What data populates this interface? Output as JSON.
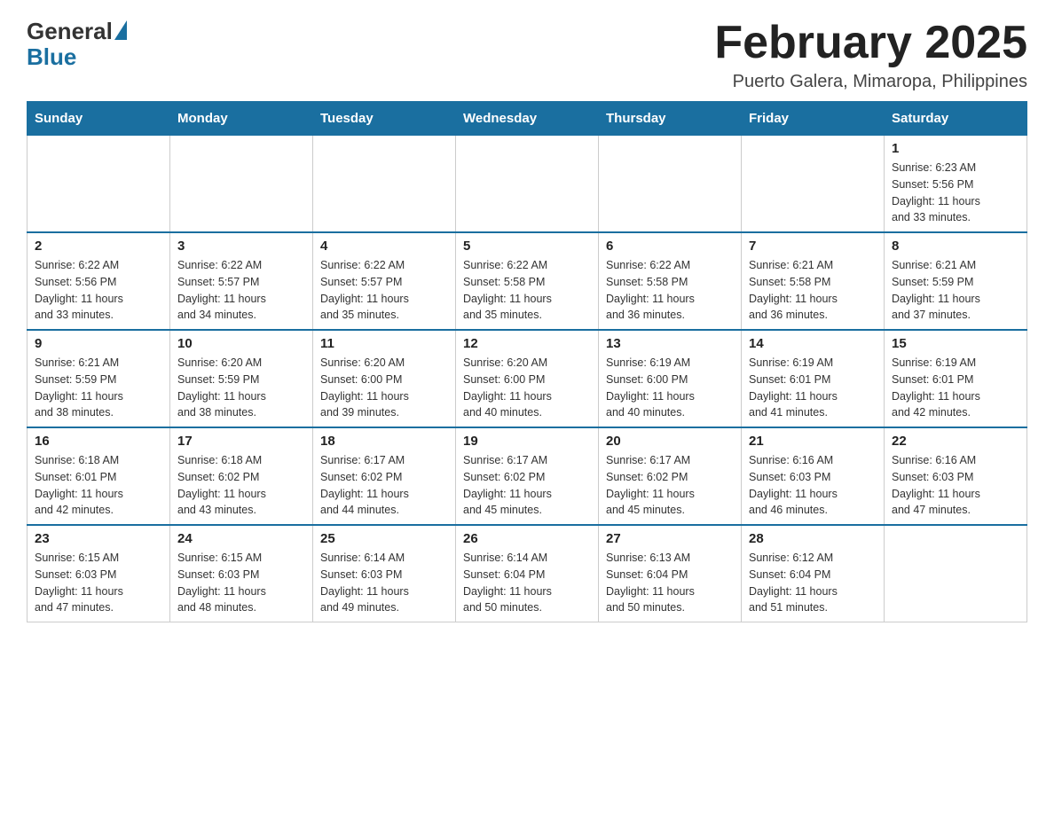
{
  "header": {
    "logo_general": "General",
    "logo_blue": "Blue",
    "month_title": "February 2025",
    "location": "Puerto Galera, Mimaropa, Philippines"
  },
  "weekdays": [
    "Sunday",
    "Monday",
    "Tuesday",
    "Wednesday",
    "Thursday",
    "Friday",
    "Saturday"
  ],
  "weeks": [
    {
      "days": [
        {
          "number": "",
          "info": ""
        },
        {
          "number": "",
          "info": ""
        },
        {
          "number": "",
          "info": ""
        },
        {
          "number": "",
          "info": ""
        },
        {
          "number": "",
          "info": ""
        },
        {
          "number": "",
          "info": ""
        },
        {
          "number": "1",
          "info": "Sunrise: 6:23 AM\nSunset: 5:56 PM\nDaylight: 11 hours\nand 33 minutes."
        }
      ]
    },
    {
      "days": [
        {
          "number": "2",
          "info": "Sunrise: 6:22 AM\nSunset: 5:56 PM\nDaylight: 11 hours\nand 33 minutes."
        },
        {
          "number": "3",
          "info": "Sunrise: 6:22 AM\nSunset: 5:57 PM\nDaylight: 11 hours\nand 34 minutes."
        },
        {
          "number": "4",
          "info": "Sunrise: 6:22 AM\nSunset: 5:57 PM\nDaylight: 11 hours\nand 35 minutes."
        },
        {
          "number": "5",
          "info": "Sunrise: 6:22 AM\nSunset: 5:58 PM\nDaylight: 11 hours\nand 35 minutes."
        },
        {
          "number": "6",
          "info": "Sunrise: 6:22 AM\nSunset: 5:58 PM\nDaylight: 11 hours\nand 36 minutes."
        },
        {
          "number": "7",
          "info": "Sunrise: 6:21 AM\nSunset: 5:58 PM\nDaylight: 11 hours\nand 36 minutes."
        },
        {
          "number": "8",
          "info": "Sunrise: 6:21 AM\nSunset: 5:59 PM\nDaylight: 11 hours\nand 37 minutes."
        }
      ]
    },
    {
      "days": [
        {
          "number": "9",
          "info": "Sunrise: 6:21 AM\nSunset: 5:59 PM\nDaylight: 11 hours\nand 38 minutes."
        },
        {
          "number": "10",
          "info": "Sunrise: 6:20 AM\nSunset: 5:59 PM\nDaylight: 11 hours\nand 38 minutes."
        },
        {
          "number": "11",
          "info": "Sunrise: 6:20 AM\nSunset: 6:00 PM\nDaylight: 11 hours\nand 39 minutes."
        },
        {
          "number": "12",
          "info": "Sunrise: 6:20 AM\nSunset: 6:00 PM\nDaylight: 11 hours\nand 40 minutes."
        },
        {
          "number": "13",
          "info": "Sunrise: 6:19 AM\nSunset: 6:00 PM\nDaylight: 11 hours\nand 40 minutes."
        },
        {
          "number": "14",
          "info": "Sunrise: 6:19 AM\nSunset: 6:01 PM\nDaylight: 11 hours\nand 41 minutes."
        },
        {
          "number": "15",
          "info": "Sunrise: 6:19 AM\nSunset: 6:01 PM\nDaylight: 11 hours\nand 42 minutes."
        }
      ]
    },
    {
      "days": [
        {
          "number": "16",
          "info": "Sunrise: 6:18 AM\nSunset: 6:01 PM\nDaylight: 11 hours\nand 42 minutes."
        },
        {
          "number": "17",
          "info": "Sunrise: 6:18 AM\nSunset: 6:02 PM\nDaylight: 11 hours\nand 43 minutes."
        },
        {
          "number": "18",
          "info": "Sunrise: 6:17 AM\nSunset: 6:02 PM\nDaylight: 11 hours\nand 44 minutes."
        },
        {
          "number": "19",
          "info": "Sunrise: 6:17 AM\nSunset: 6:02 PM\nDaylight: 11 hours\nand 45 minutes."
        },
        {
          "number": "20",
          "info": "Sunrise: 6:17 AM\nSunset: 6:02 PM\nDaylight: 11 hours\nand 45 minutes."
        },
        {
          "number": "21",
          "info": "Sunrise: 6:16 AM\nSunset: 6:03 PM\nDaylight: 11 hours\nand 46 minutes."
        },
        {
          "number": "22",
          "info": "Sunrise: 6:16 AM\nSunset: 6:03 PM\nDaylight: 11 hours\nand 47 minutes."
        }
      ]
    },
    {
      "days": [
        {
          "number": "23",
          "info": "Sunrise: 6:15 AM\nSunset: 6:03 PM\nDaylight: 11 hours\nand 47 minutes."
        },
        {
          "number": "24",
          "info": "Sunrise: 6:15 AM\nSunset: 6:03 PM\nDaylight: 11 hours\nand 48 minutes."
        },
        {
          "number": "25",
          "info": "Sunrise: 6:14 AM\nSunset: 6:03 PM\nDaylight: 11 hours\nand 49 minutes."
        },
        {
          "number": "26",
          "info": "Sunrise: 6:14 AM\nSunset: 6:04 PM\nDaylight: 11 hours\nand 50 minutes."
        },
        {
          "number": "27",
          "info": "Sunrise: 6:13 AM\nSunset: 6:04 PM\nDaylight: 11 hours\nand 50 minutes."
        },
        {
          "number": "28",
          "info": "Sunrise: 6:12 AM\nSunset: 6:04 PM\nDaylight: 11 hours\nand 51 minutes."
        },
        {
          "number": "",
          "info": ""
        }
      ]
    }
  ]
}
